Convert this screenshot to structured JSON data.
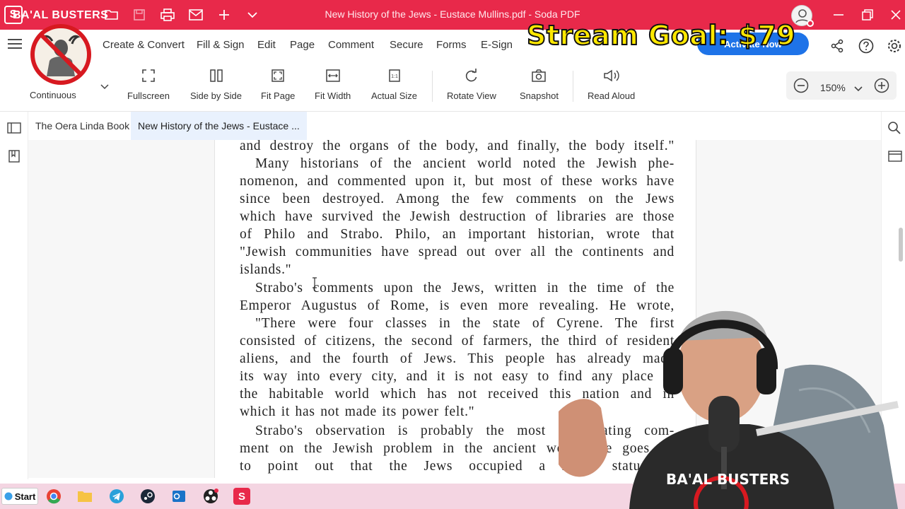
{
  "titlebar": {
    "channel_name": "BA'AL BUSTERS",
    "window_title": "New History of the Jews - Eustace Mullins.pdf  -  Soda PDF"
  },
  "menubar": {
    "items": [
      "Create & Convert",
      "Fill & Sign",
      "Edit",
      "Page",
      "Comment",
      "Secure",
      "Forms",
      "E-Sign"
    ],
    "activate_label": "Activate Now"
  },
  "toolbar": {
    "view_mode": "Continuous",
    "tools": [
      "Fullscreen",
      "Side by Side",
      "Fit Page",
      "Fit Width",
      "Actual Size",
      "Rotate View",
      "Snapshot",
      "Read Aloud"
    ],
    "zoom": "150%"
  },
  "tabs": [
    "The Oera Linda Book",
    "New History of the Jews - Eustace ..."
  ],
  "document": {
    "lines": [
      "and destroy the organs of the body, and finally, the body itself.\"",
      "Many historians of the ancient world noted the Jewish phe-",
      "nomenon, and commented upon it, but most of these works have",
      "since been destroyed.  Among the few comments on the Jews",
      "which have survived the Jewish destruction of libraries are those",
      "of Philo and Strabo.  Philo, an important historian, wrote that",
      "\"Jewish communities have spread out over all the continents and",
      "islands.\"",
      "Strabo's comments upon the Jews, written in the time of the",
      "Emperor Augustus of Rome, is even more revealing. He wrote,",
      "\"There were four classes in the state of Cyrene.  The first",
      "consisted of citizens, the second of farmers, the third of resident",
      "aliens, and the fourth of Jews.  This people has already made",
      "its way into every city, and it is not easy to find any place in",
      "the habitable world which has not received this nation and in",
      "which it has not made its power felt.\"",
      "Strabo's observation is probably the most illuminating com-",
      "ment on the Jewish problem in the ancient world. He goes on",
      "to point out that the Jews occupied a lower status in"
    ]
  },
  "taskbar": {
    "start_label": "Start"
  },
  "overlay": {
    "stream_goal": "Stream Goal: $79",
    "shirt_text": "BA'AL BUSTERS"
  },
  "colors": {
    "titlebar": "#e8294a",
    "accent": "#1e73e8",
    "goal_text": "#ffe800"
  }
}
